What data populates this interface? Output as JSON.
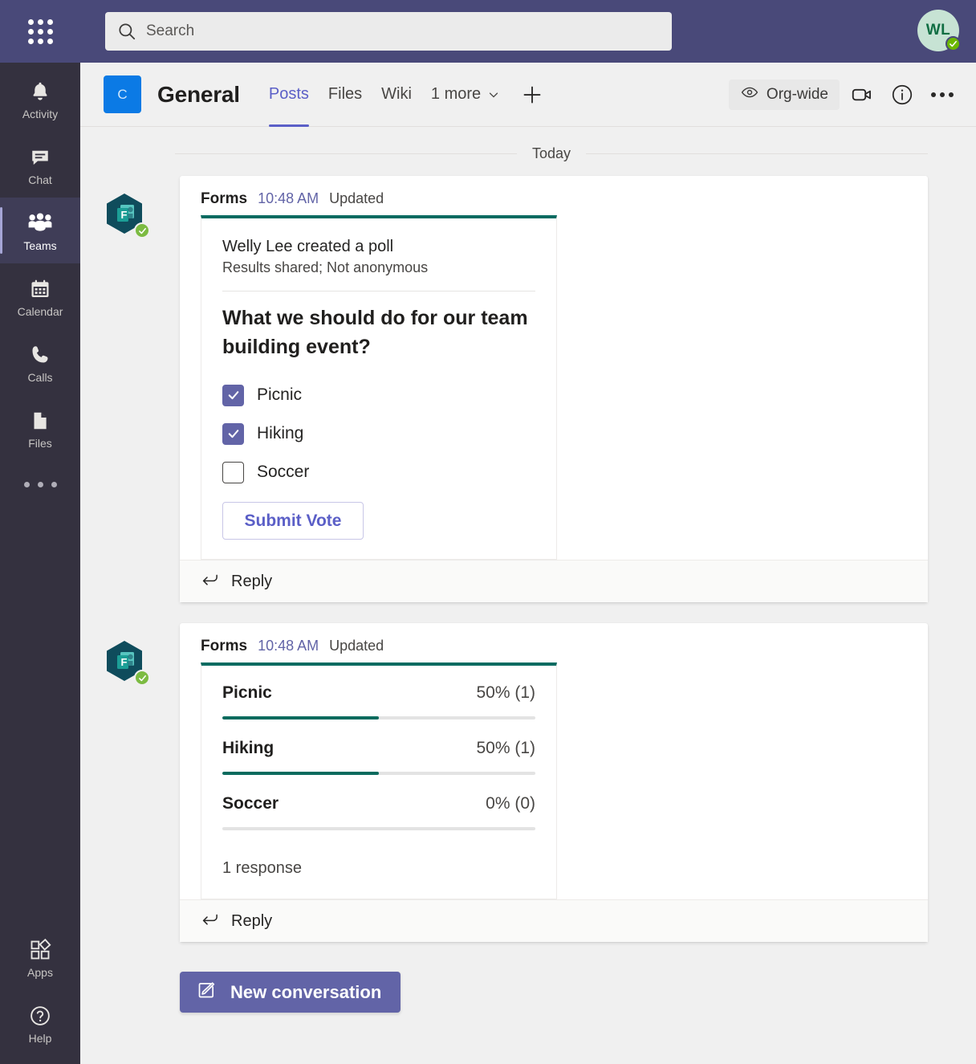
{
  "topbar": {
    "waffle_label": "app-launcher",
    "search": {
      "placeholder": "Search",
      "value": ""
    },
    "avatar": {
      "initials": "WL",
      "presence": "available"
    }
  },
  "rail": {
    "items": [
      {
        "icon": "bell-icon",
        "label": "Activity",
        "active": false
      },
      {
        "icon": "chat-icon",
        "label": "Chat",
        "active": false
      },
      {
        "icon": "teams-icon",
        "label": "Teams",
        "active": true
      },
      {
        "icon": "calendar-icon",
        "label": "Calendar",
        "active": false
      },
      {
        "icon": "phone-icon",
        "label": "Calls",
        "active": false
      },
      {
        "icon": "file-icon",
        "label": "Files",
        "active": false
      }
    ],
    "more_label": "more-apps",
    "bottom": [
      {
        "icon": "apps-icon",
        "label": "Apps"
      },
      {
        "icon": "help-icon",
        "label": "Help"
      }
    ]
  },
  "channel": {
    "team_initial": "C",
    "title": "General",
    "tabs": [
      {
        "label": "Posts",
        "active": true
      },
      {
        "label": "Files",
        "active": false
      },
      {
        "label": "Wiki",
        "active": false
      },
      {
        "label": "1 more",
        "active": false,
        "has_chevron": true
      }
    ],
    "add_tab_label": "+",
    "org_wide_label": "Org-wide",
    "header_icons": [
      "meet-now-icon",
      "channel-info-icon",
      "more-options-icon"
    ]
  },
  "conversation": {
    "day_divider": "Today",
    "messages": [
      {
        "author": "Forms",
        "time": "10:48 AM",
        "edited": "Updated",
        "avatar": "forms-app-icon",
        "reply_label": "Reply",
        "poll": {
          "creator_line": "Welly Lee created a poll",
          "settings_line": "Results shared; Not anonymous",
          "question": "What we should do for our team building event?",
          "options": [
            {
              "label": "Picnic",
              "checked": true
            },
            {
              "label": "Hiking",
              "checked": true
            },
            {
              "label": "Soccer",
              "checked": false
            }
          ],
          "submit_label": "Submit Vote"
        }
      },
      {
        "author": "Forms",
        "time": "10:48 AM",
        "edited": "Updated",
        "avatar": "forms-app-icon",
        "reply_label": "Reply",
        "results": {
          "rows": [
            {
              "label": "Picnic",
              "value": "50% (1)",
              "percent": 50
            },
            {
              "label": "Hiking",
              "value": "50% (1)",
              "percent": 50
            },
            {
              "label": "Soccer",
              "value": "0% (0)",
              "percent": 0
            }
          ],
          "response_count": "1 response"
        }
      }
    ],
    "new_conversation_label": "New conversation"
  },
  "colors": {
    "topbar": "#494979",
    "rail": "#34313f",
    "accent_purple": "#6264a7",
    "tab_active": "#5b5fc7",
    "forms_green": "#096b61",
    "bar_fill": "#0a6b5e",
    "team_badge_blue": "#0b7ae5",
    "presence_green": "#6bb700"
  }
}
